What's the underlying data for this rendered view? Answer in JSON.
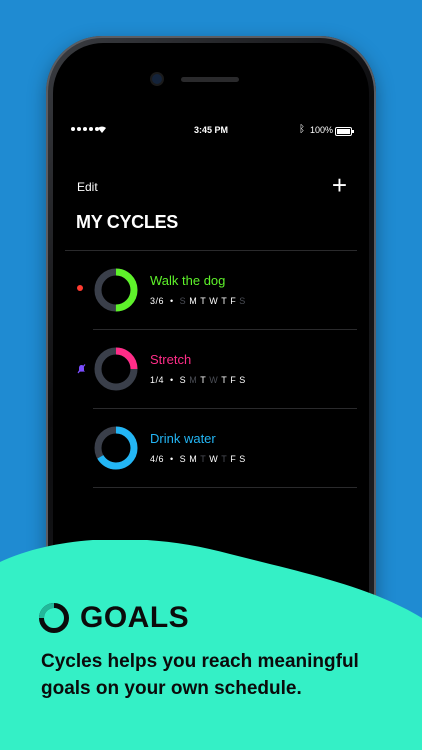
{
  "colors": {
    "background": "#1f8bd2",
    "bottom_panel": "#34f0c6",
    "green": "#5ef22a",
    "pink": "#ff2d88",
    "blue": "#23b6f5",
    "ring_track": "#3a3f4a"
  },
  "status_bar": {
    "time": "3:45 PM",
    "battery": "100%"
  },
  "header": {
    "edit_label": "Edit",
    "add_label": "+",
    "title": "MY CYCLES"
  },
  "cycles": [
    {
      "name": "Walk the dog",
      "progress_text": "3/6",
      "progress": 0.5,
      "color": "#5ef22a",
      "marker": "red-dot",
      "days": [
        "S",
        "M",
        "T",
        "W",
        "T",
        "F",
        "S"
      ],
      "active_days": [
        false,
        true,
        true,
        true,
        true,
        true,
        false
      ]
    },
    {
      "name": "Stretch",
      "progress_text": "1/4",
      "progress": 0.25,
      "color": "#ff2d88",
      "marker": "muted-bell-icon",
      "days": [
        "S",
        "M",
        "T",
        "W",
        "T",
        "F",
        "S"
      ],
      "active_days": [
        true,
        false,
        true,
        false,
        true,
        true,
        true
      ]
    },
    {
      "name": "Drink water",
      "progress_text": "4/6",
      "progress": 0.6667,
      "color": "#23b6f5",
      "marker": "",
      "days": [
        "S",
        "M",
        "T",
        "W",
        "T",
        "F",
        "S"
      ],
      "active_days": [
        true,
        true,
        false,
        true,
        false,
        true,
        true
      ]
    }
  ],
  "promo": {
    "heading": "GOALS",
    "tagline": "Cycles helps you reach meaningful goals on your own schedule."
  }
}
